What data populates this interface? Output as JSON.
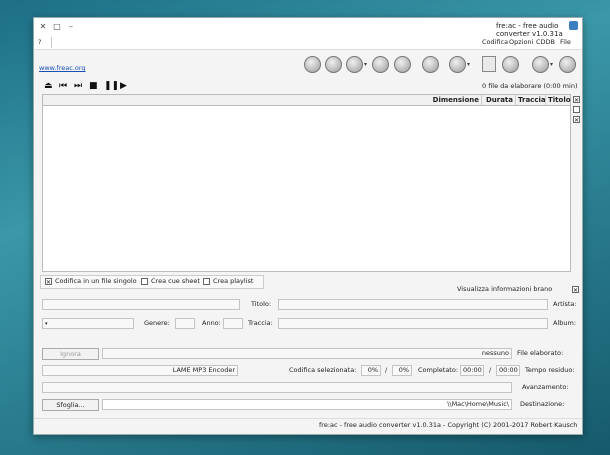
{
  "window": {
    "title": "fre:ac - free audio converter v1.0.31a"
  },
  "menu": {
    "items": [
      "File",
      "CDDB",
      "Opzioni",
      "Codifica"
    ],
    "help": "?"
  },
  "link": "www.freac.org",
  "summary": "0 file da elaborare (0:00 min)",
  "table": {
    "columns": [
      "Titolo",
      "Traccia",
      "Durata",
      "Dimensione"
    ]
  },
  "options": {
    "show_info": "Visualizza informazioni brano",
    "playlist": "Crea playlist",
    "cue": "Crea cue sheet",
    "single": "Codifica in un file singolo"
  },
  "info": {
    "artist": "Artista:",
    "title": "Titolo:",
    "album": "Album:",
    "track": "Traccia:",
    "year": "Anno:",
    "genre": "Genere:"
  },
  "status": {
    "file_label": "File elaborato:",
    "file_value": "nessuno",
    "ignore": "Ignora",
    "time_label": "Tempo residuo:",
    "time_value": "00:00",
    "time_sep": "/",
    "time_total": "00:00",
    "completed_label": "Completato:",
    "completed_value": "0%",
    "completed_sep": "/",
    "completed_total": "0%",
    "encoder_label": "Codifica selezionata:",
    "encoder_value": "LAME MP3 Encoder",
    "progress_label": "Avanzamento:",
    "dest_label": "Destinazione:",
    "dest_value": "\\\\Mac\\Home\\Music\\",
    "browse": "Sfoglia..."
  },
  "footer": "fre:ac - free audio converter v1.0.31a - Copyright (C) 2001-2017 Robert Kausch"
}
